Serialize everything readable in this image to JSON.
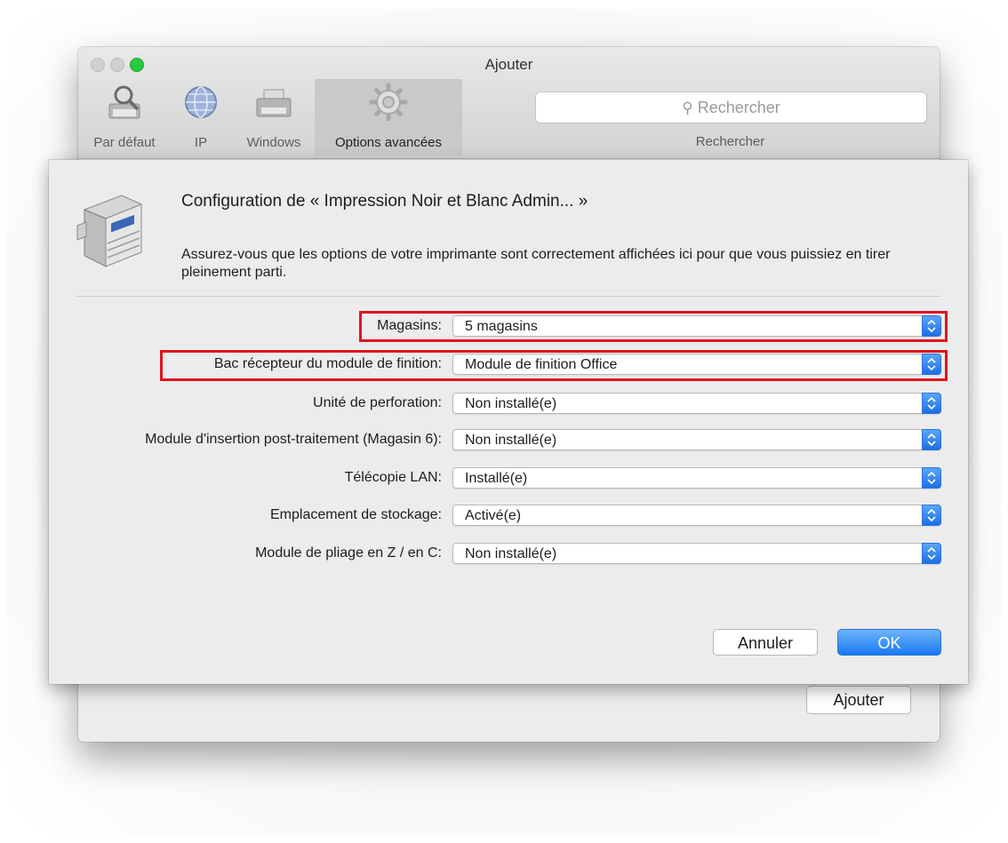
{
  "window": {
    "title": "Ajouter",
    "toolbar": {
      "items": [
        {
          "label": "Par défaut",
          "icon": "default-printer-icon"
        },
        {
          "label": "IP",
          "icon": "globe-icon"
        },
        {
          "label": "Windows",
          "icon": "windows-printer-icon"
        },
        {
          "label": "Options avancées",
          "icon": "gear-icon"
        }
      ],
      "search": {
        "placeholder": "Rechercher",
        "caption": "Rechercher"
      }
    },
    "add_button": "Ajouter"
  },
  "sheet": {
    "title": "Configuration de « Impression Noir et Blanc Admin... »",
    "description": "Assurez-vous que les options de votre imprimante sont correctement affichées ici pour que vous puissiez en tirer pleinement parti.",
    "options": [
      {
        "label": "Magasins:",
        "value": "5 magasins"
      },
      {
        "label": "Bac récepteur du module de finition:",
        "value": "Module de finition Office"
      },
      {
        "label": "Unité de perforation:",
        "value": "Non installé(e)"
      },
      {
        "label": "Module d'insertion post-traitement (Magasin 6):",
        "value": "Non installé(e)"
      },
      {
        "label": "Télécopie LAN:",
        "value": "Installé(e)"
      },
      {
        "label": "Emplacement de stockage:",
        "value": "Activé(e)"
      },
      {
        "label": "Module de pliage en Z / en C:",
        "value": "Non installé(e)"
      }
    ],
    "buttons": {
      "cancel": "Annuler",
      "ok": "OK"
    }
  },
  "colors": {
    "accent": "#1a79f3",
    "highlight": "#e0141e",
    "zoom": "#28c840"
  }
}
